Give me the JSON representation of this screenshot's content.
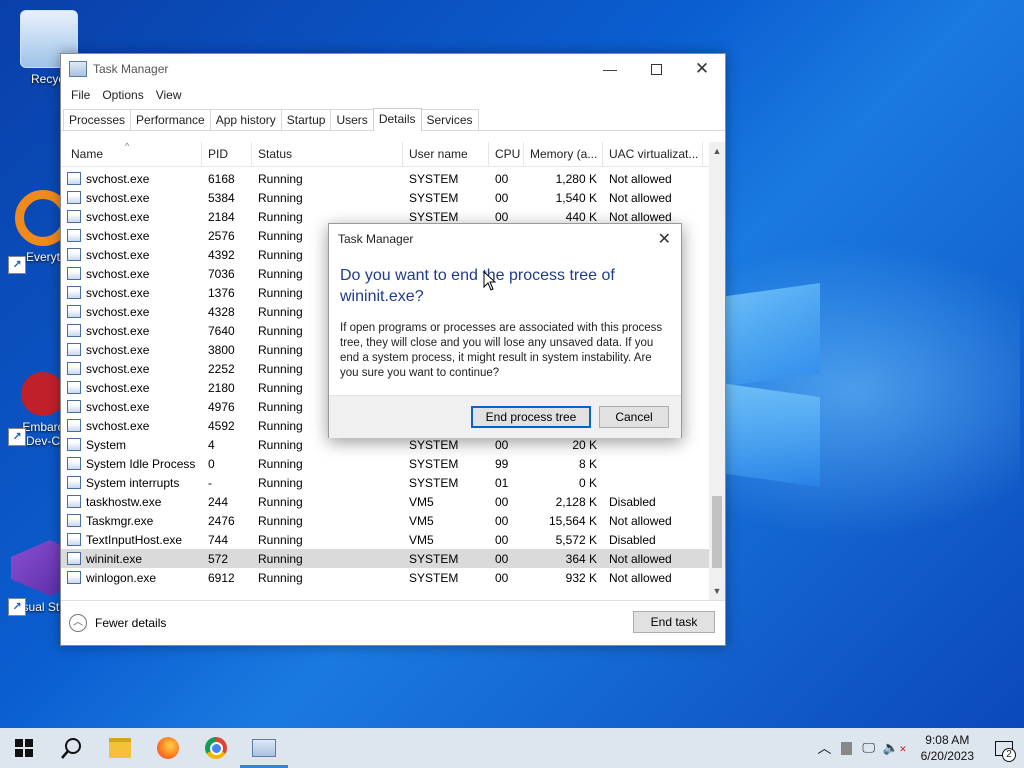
{
  "desktop": {
    "icons": [
      {
        "label": "Recycl"
      },
      {
        "label": "Everyt"
      },
      {
        "label": "Embarc\nDev-C"
      },
      {
        "label": "Visual Stu"
      }
    ]
  },
  "window": {
    "title": "Task Manager",
    "menu": [
      "File",
      "Options",
      "View"
    ],
    "tabs": [
      "Processes",
      "Performance",
      "App history",
      "Startup",
      "Users",
      "Details",
      "Services"
    ],
    "active_tab": "Details",
    "columns": [
      "Name",
      "PID",
      "Status",
      "User name",
      "CPU",
      "Memory (a...",
      "UAC virtualizat..."
    ],
    "rows": [
      {
        "name": "svchost.exe",
        "pid": "6168",
        "status": "Running",
        "user": "SYSTEM",
        "cpu": "00",
        "mem": "1,280 K",
        "uac": "Not allowed"
      },
      {
        "name": "svchost.exe",
        "pid": "5384",
        "status": "Running",
        "user": "SYSTEM",
        "cpu": "00",
        "mem": "1,540 K",
        "uac": "Not allowed"
      },
      {
        "name": "svchost.exe",
        "pid": "2184",
        "status": "Running",
        "user": "SYSTEM",
        "cpu": "00",
        "mem": "440 K",
        "uac": "Not allowed"
      },
      {
        "name": "svchost.exe",
        "pid": "2576",
        "status": "Running",
        "user": "",
        "cpu": "",
        "mem": "",
        "uac": ""
      },
      {
        "name": "svchost.exe",
        "pid": "4392",
        "status": "Running",
        "user": "",
        "cpu": "",
        "mem": "",
        "uac": ""
      },
      {
        "name": "svchost.exe",
        "pid": "7036",
        "status": "Running",
        "user": "",
        "cpu": "",
        "mem": "",
        "uac": ""
      },
      {
        "name": "svchost.exe",
        "pid": "1376",
        "status": "Running",
        "user": "",
        "cpu": "",
        "mem": "",
        "uac": ""
      },
      {
        "name": "svchost.exe",
        "pid": "4328",
        "status": "Running",
        "user": "",
        "cpu": "",
        "mem": "",
        "uac": ""
      },
      {
        "name": "svchost.exe",
        "pid": "7640",
        "status": "Running",
        "user": "",
        "cpu": "",
        "mem": "",
        "uac": ""
      },
      {
        "name": "svchost.exe",
        "pid": "3800",
        "status": "Running",
        "user": "",
        "cpu": "",
        "mem": "",
        "uac": ""
      },
      {
        "name": "svchost.exe",
        "pid": "2252",
        "status": "Running",
        "user": "",
        "cpu": "",
        "mem": "",
        "uac": ""
      },
      {
        "name": "svchost.exe",
        "pid": "2180",
        "status": "Running",
        "user": "",
        "cpu": "",
        "mem": "",
        "uac": ""
      },
      {
        "name": "svchost.exe",
        "pid": "4976",
        "status": "Running",
        "user": "",
        "cpu": "",
        "mem": "",
        "uac": ""
      },
      {
        "name": "svchost.exe",
        "pid": "4592",
        "status": "Running",
        "user": "",
        "cpu": "",
        "mem": "",
        "uac": ""
      },
      {
        "name": "System",
        "pid": "4",
        "status": "Running",
        "user": "SYSTEM",
        "cpu": "00",
        "mem": "20 K",
        "uac": ""
      },
      {
        "name": "System Idle Process",
        "pid": "0",
        "status": "Running",
        "user": "SYSTEM",
        "cpu": "99",
        "mem": "8 K",
        "uac": ""
      },
      {
        "name": "System interrupts",
        "pid": "-",
        "status": "Running",
        "user": "SYSTEM",
        "cpu": "01",
        "mem": "0 K",
        "uac": ""
      },
      {
        "name": "taskhostw.exe",
        "pid": "244",
        "status": "Running",
        "user": "VM5",
        "cpu": "00",
        "mem": "2,128 K",
        "uac": "Disabled"
      },
      {
        "name": "Taskmgr.exe",
        "pid": "2476",
        "status": "Running",
        "user": "VM5",
        "cpu": "00",
        "mem": "15,564 K",
        "uac": "Not allowed"
      },
      {
        "name": "TextInputHost.exe",
        "pid": "744",
        "status": "Running",
        "user": "VM5",
        "cpu": "00",
        "mem": "5,572 K",
        "uac": "Disabled"
      },
      {
        "name": "wininit.exe",
        "pid": "572",
        "status": "Running",
        "user": "SYSTEM",
        "cpu": "00",
        "mem": "364 K",
        "uac": "Not allowed",
        "selected": true
      },
      {
        "name": "winlogon.exe",
        "pid": "6912",
        "status": "Running",
        "user": "SYSTEM",
        "cpu": "00",
        "mem": "932 K",
        "uac": "Not allowed"
      }
    ],
    "fewer_details": "Fewer details",
    "end_task": "End task"
  },
  "dialog": {
    "title": "Task Manager",
    "question": "Do you want to end the process tree of wininit.exe?",
    "body": "If open programs or processes are associated with this process tree, they will close and you will lose any unsaved data. If you end a system process, it might result in system instability. Are you sure you want to continue?",
    "confirm": "End process tree",
    "cancel": "Cancel"
  },
  "taskbar": {
    "time": "9:08 AM",
    "date": "6/20/2023",
    "notification_count": "2"
  },
  "colors": {
    "accent": "#1f3c8c",
    "selected_row": "#dadada",
    "taskbar": "#dde5ef"
  }
}
